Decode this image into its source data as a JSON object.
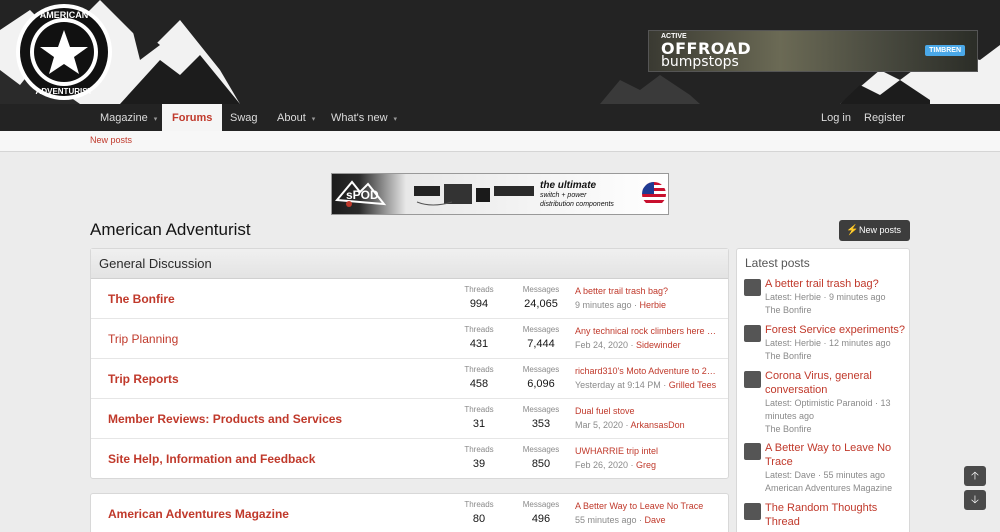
{
  "header": {
    "logo_text": "AMERICAN ADVENTURIST TRAVEL EXPLORE LIVE",
    "banner_ad": {
      "top": "ACTIVE",
      "line1": "OFFROAD",
      "line2": "bumpstops",
      "brand": "TIMBREN"
    }
  },
  "nav": {
    "items": [
      {
        "label": "Magazine",
        "caret": "▾"
      },
      {
        "label": "Forums"
      },
      {
        "label": "Swag"
      },
      {
        "label": "About",
        "caret": "▾"
      },
      {
        "label": "What's new",
        "caret": "▾"
      }
    ],
    "login": "Log in",
    "register": "Register",
    "subnav_new_posts": "New posts"
  },
  "pod_ad": {
    "brand": "sPOD",
    "line1": "the ultimate",
    "line2": "switch + power",
    "line3": "distribution components"
  },
  "page_title": "American Adventurist",
  "new_posts_button": "New posts",
  "general_discussion": {
    "title": "General Discussion",
    "stat_labels": {
      "threads": "Threads",
      "messages": "Messages"
    },
    "forums": [
      {
        "name": "The Bonfire",
        "bold": true,
        "threads": "994",
        "messages": "24,065",
        "last_title": "A better trail trash bag?",
        "last_time": "9 minutes ago",
        "last_user": "Herbie"
      },
      {
        "name": "Trip Planning",
        "bold": false,
        "threads": "431",
        "messages": "7,444",
        "last_title": "Any technical rock climbers here …",
        "last_time": "Feb 24, 2020",
        "last_user": "Sidewinder"
      },
      {
        "name": "Trip Reports",
        "bold": true,
        "threads": "458",
        "messages": "6,096",
        "last_title": "richard310's Moto Adventure to 2…",
        "last_time": "Yesterday at 9:14 PM",
        "last_user": "Grilled Tees"
      },
      {
        "name": "Member Reviews: Products and Services",
        "bold": true,
        "threads": "31",
        "messages": "353",
        "last_title": "Dual fuel stove",
        "last_time": "Mar 5, 2020",
        "last_user": "ArkansasDon"
      },
      {
        "name": "Site Help, Information and Feedback",
        "bold": true,
        "threads": "39",
        "messages": "850",
        "last_title": "UWHARRIE trip intel",
        "last_time": "Feb 26, 2020",
        "last_user": "Greg"
      }
    ]
  },
  "magazine_forum": {
    "name": "American Adventures Magazine",
    "threads": "80",
    "messages": "496",
    "last_title": "A Better Way to Leave No Trace",
    "last_time": "55 minutes ago",
    "last_user": "Dave"
  },
  "sidebar": {
    "title": "Latest posts",
    "posts": [
      {
        "title": "A better trail trash bag?",
        "meta": "Latest: Herbie · 9 minutes ago",
        "forum": "The Bonfire"
      },
      {
        "title": "Forest Service experiments?",
        "meta": "Latest: Herbie · 12 minutes ago",
        "forum": "The Bonfire"
      },
      {
        "title": "Corona Virus, general conversation",
        "meta": "Latest: Optimistic Paranoid · 13 minutes ago",
        "forum": "The Bonfire"
      },
      {
        "title": "A Better Way to Leave No Trace",
        "meta": "Latest: Dave · 55 minutes ago",
        "forum": "American Adventures Magazine"
      },
      {
        "title": "The Random Thoughts Thread",
        "meta": "",
        "forum": ""
      }
    ]
  },
  "scroll": {
    "up": "🡡",
    "down": "🡣"
  }
}
